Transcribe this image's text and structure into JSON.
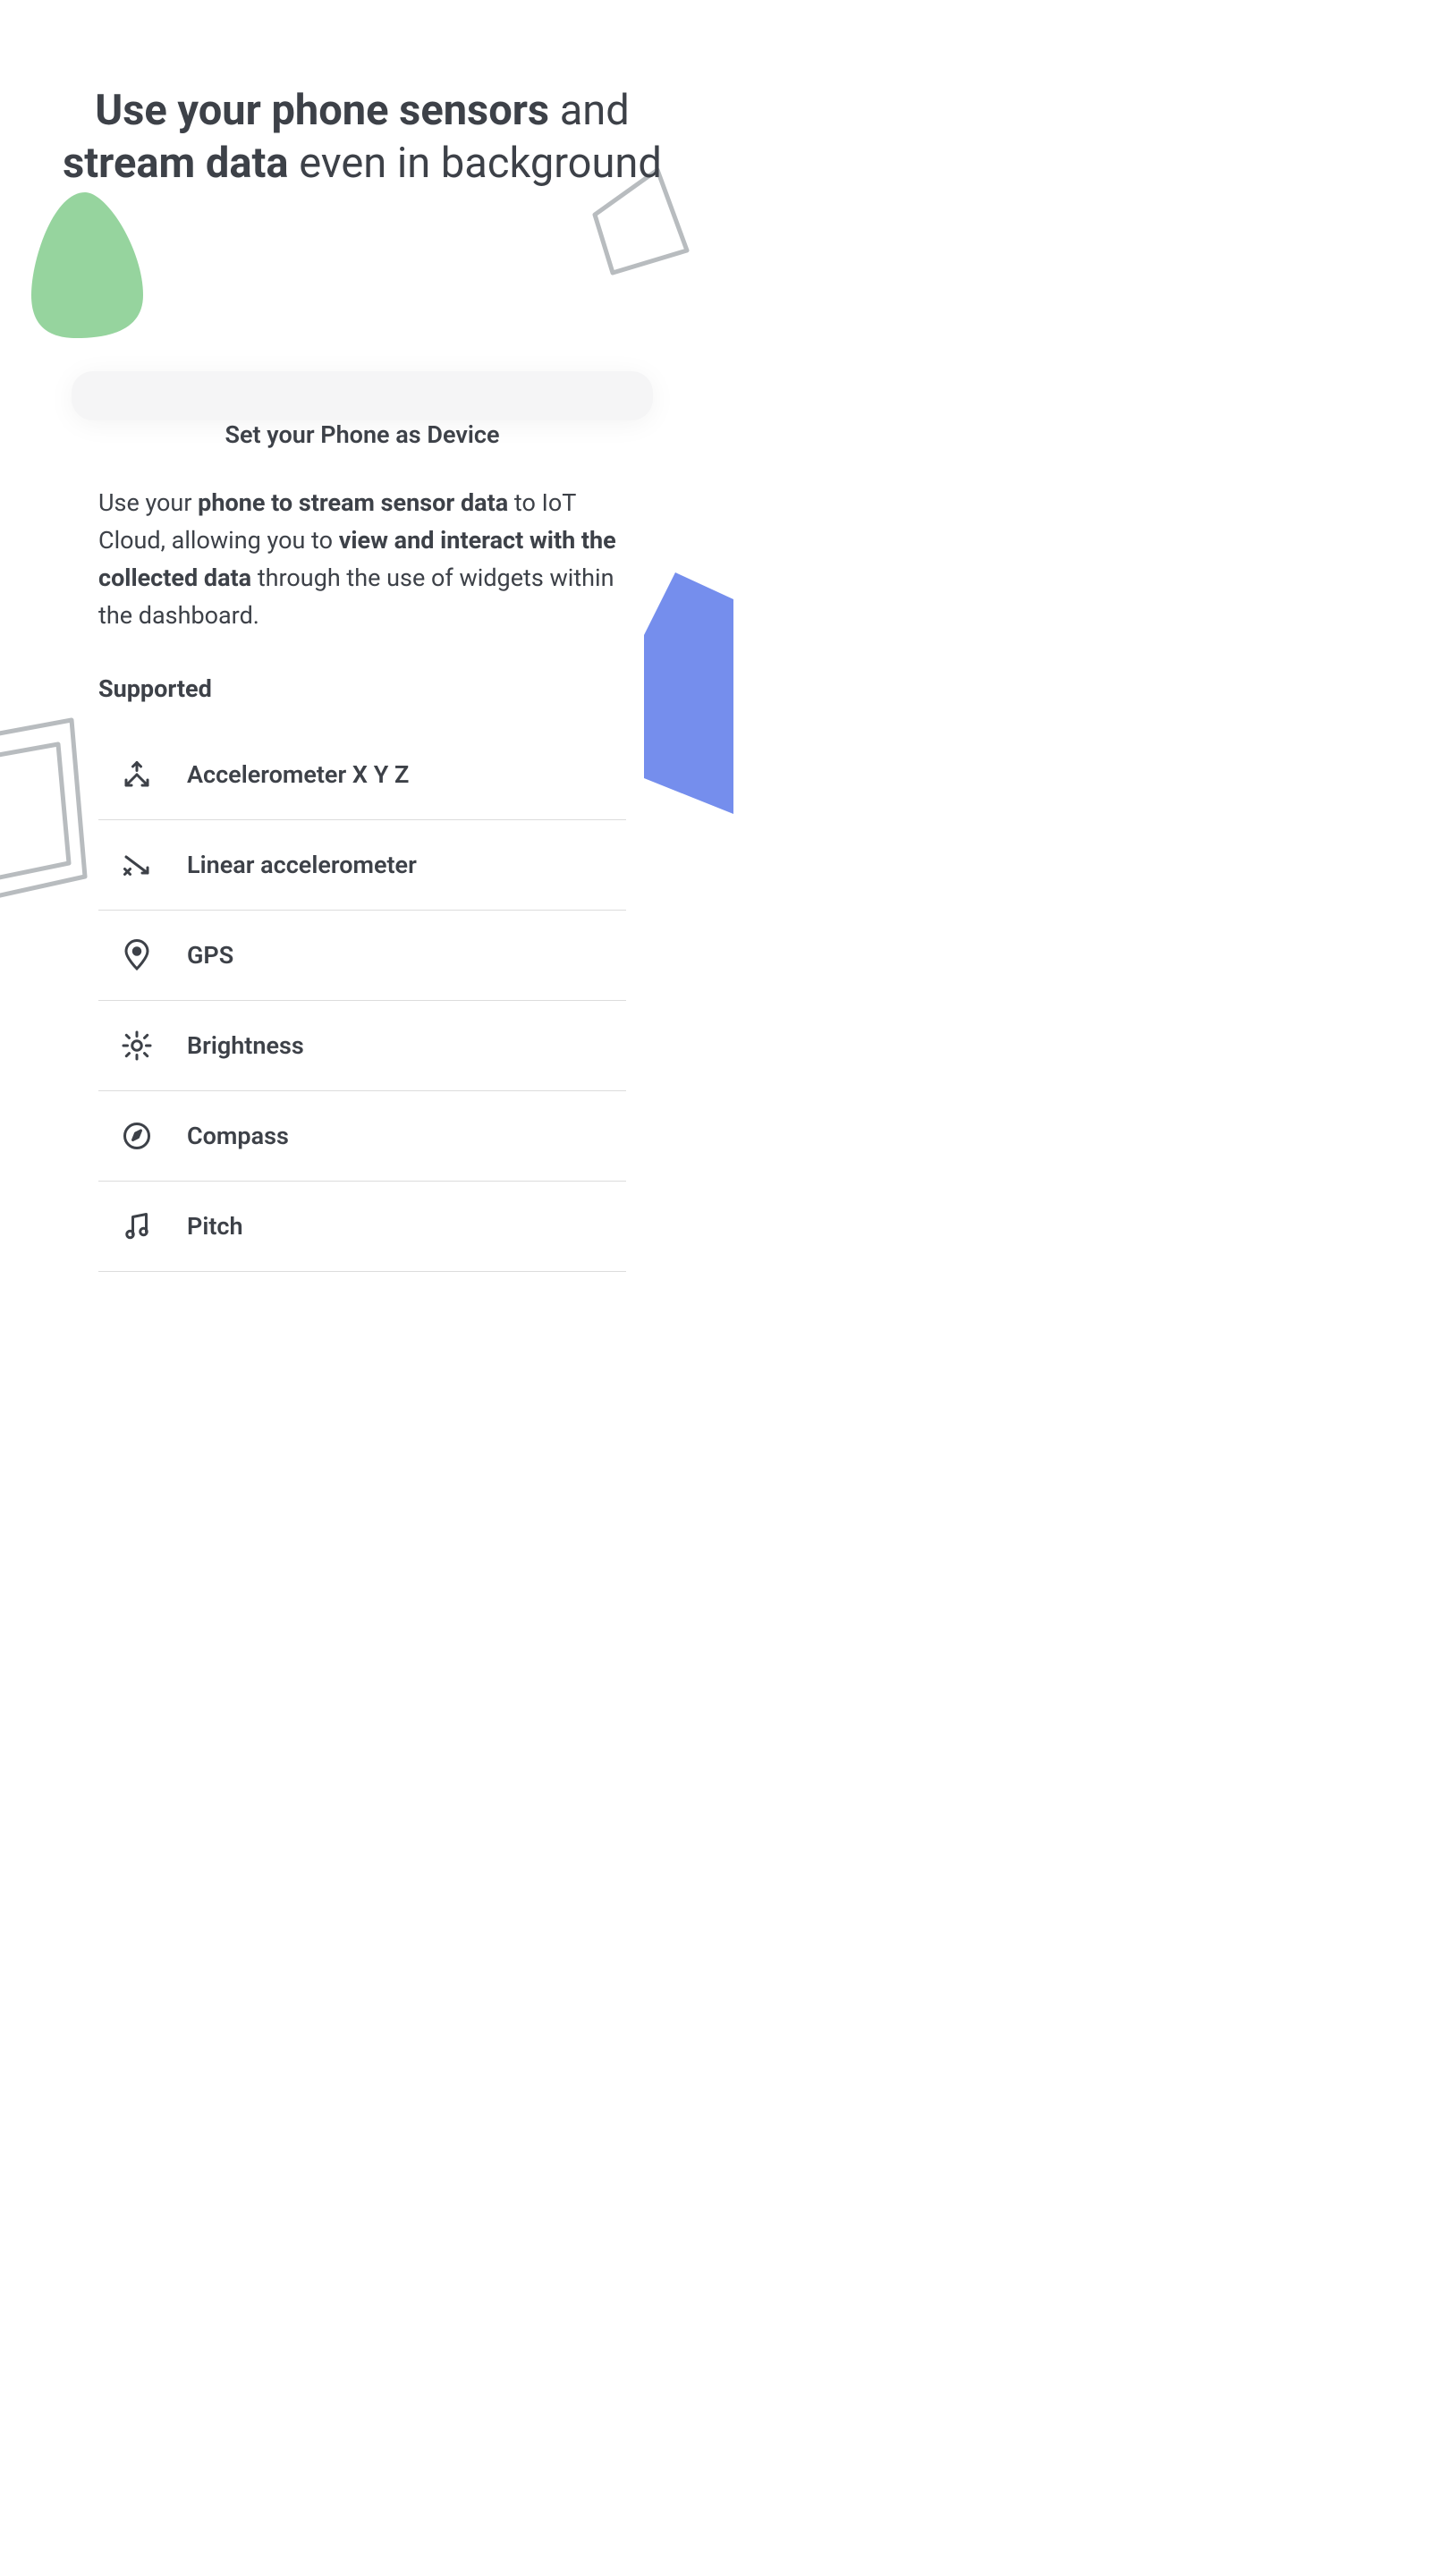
{
  "heading": {
    "part1": "Use your phone sensors",
    "part2": " and ",
    "part3": "stream data",
    "part4": " even in background"
  },
  "card": {
    "title": "Set your Phone as Device",
    "desc": {
      "p1": "Use your ",
      "b1": "phone to stream sensor data",
      "p2": " to IoT Cloud, allowing you to ",
      "b2": "view and interact with the collected data",
      "p3": " through the use of widgets within the dashboard."
    },
    "supported_label": "Supported",
    "sensors": [
      {
        "label": "Accelerometer X Y Z",
        "icon": "accelerometer"
      },
      {
        "label": "Linear accelerometer",
        "icon": "linear"
      },
      {
        "label": "GPS",
        "icon": "gps"
      },
      {
        "label": "Brightness",
        "icon": "brightness"
      },
      {
        "label": "Compass",
        "icon": "compass"
      },
      {
        "label": "Pitch",
        "icon": "pitch"
      }
    ]
  }
}
